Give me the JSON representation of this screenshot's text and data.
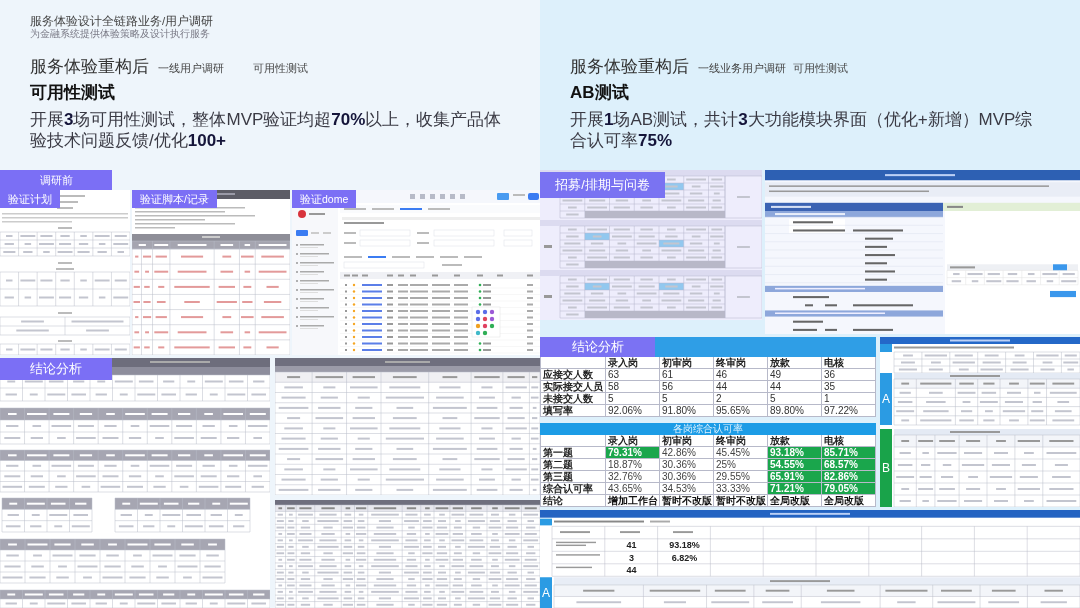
{
  "intro": {
    "title": "服务体验设计全链路业务/用户调研",
    "subtitle": "为金融系统提供体验策略及设计执行服务"
  },
  "panels": [
    {
      "heading": "服务体验重构后",
      "steps": [
        "一线用户调研",
        "可用性测试"
      ],
      "subheading": "可用性测试",
      "summary": "开展**3**场可用性测试，整体MVP验证均超**70%**以上，收集产品体验技术问题反馈/优化**100+**",
      "stage_tag": "调研前",
      "documents": [
        {
          "kind": "plan",
          "tag": "验证计划"
        },
        {
          "kind": "script",
          "tag": "验证脚本/记录"
        },
        {
          "kind": "app",
          "tag": "验证dome"
        },
        {
          "kind": "sheets",
          "tag": "结论分析"
        },
        {
          "kind": "issues"
        },
        {
          "kind": "log"
        }
      ]
    },
    {
      "heading": "服务体验重构后",
      "steps": [
        "一线业务用户调研",
        "可用性测试"
      ],
      "subheading": "AB测试",
      "summary": "开展**1**场AB测试，共计**3**大功能模块界面（优化+新增）MVP综合认可率**75%**",
      "documents": [
        {
          "kind": "schedule",
          "tag": "招募/排期与问卷"
        },
        {
          "kind": "questionnaire"
        },
        {
          "kind": "ab",
          "groups": [
            "A",
            "B"
          ]
        },
        {
          "kind": "vote",
          "groups": [
            "A"
          ],
          "figures": [
            [
              "41",
              "93.18%"
            ],
            [
              "3",
              "6.82%"
            ],
            [
              "44"
            ]
          ]
        }
      ],
      "conclusion_tag": "结论分析",
      "response_table": {
        "columns": [
          "录入岗",
          "初审岗",
          "终审岗",
          "放款",
          "电核"
        ],
        "rows": [
          {
            "label": "应接交人数",
            "cells": [
              "63",
              "61",
              "46",
              "49",
              "36"
            ]
          },
          {
            "label": "实际接交人员",
            "cells": [
              "58",
              "56",
              "44",
              "44",
              "35"
            ]
          },
          {
            "label": "未接交人数",
            "cells": [
              "5",
              "5",
              "2",
              "5",
              "1"
            ]
          },
          {
            "label": "填写率",
            "cells": [
              "92.06%",
              "91.80%",
              "95.65%",
              "89.80%",
              "97.22%"
            ]
          }
        ]
      },
      "approval_table": {
        "title": "各岗综合认可率",
        "columns": [
          "录入岗",
          "初审岗",
          "终审岗",
          "放款",
          "电核"
        ],
        "rows": [
          {
            "kind": "score",
            "label": "第一题",
            "cells": [
              {
                "value": "79.31%",
                "highlighted": true
              },
              {
                "value": "42.86%",
                "highlighted": false
              },
              {
                "value": "45.45%",
                "highlighted": false
              },
              {
                "value": "93.18%",
                "highlighted": true
              },
              {
                "value": "85.71%",
                "highlighted": true
              }
            ]
          },
          {
            "kind": "score",
            "label": "第二题",
            "cells": [
              {
                "value": "18.87%",
                "highlighted": false
              },
              {
                "value": "30.36%",
                "highlighted": false
              },
              {
                "value": "25%",
                "highlighted": false
              },
              {
                "value": "54.55%",
                "highlighted": true
              },
              {
                "value": "68.57%",
                "highlighted": true
              }
            ]
          },
          {
            "kind": "score",
            "label": "第三题",
            "cells": [
              {
                "value": "32.76%",
                "highlighted": false
              },
              {
                "value": "30.36%",
                "highlighted": false
              },
              {
                "value": "29.55%",
                "highlighted": false
              },
              {
                "value": "65.91%",
                "highlighted": true
              },
              {
                "value": "82.86%",
                "highlighted": true
              }
            ]
          },
          {
            "kind": "score",
            "label": "综合认可率",
            "cells": [
              {
                "value": "43.65%",
                "highlighted": false
              },
              {
                "value": "34.53%",
                "highlighted": false
              },
              {
                "value": "33.33%",
                "highlighted": false
              },
              {
                "value": "71.21%",
                "highlighted": true
              },
              {
                "value": "79.05%",
                "highlighted": true
              }
            ]
          },
          {
            "kind": "conclusion",
            "label": "结论",
            "cells": [
              {
                "value": "增加工作台",
                "highlighted": false
              },
              {
                "value": "暂时不改版",
                "highlighted": false
              },
              {
                "value": "暂时不改版",
                "highlighted": false
              },
              {
                "value": "全局改版",
                "highlighted": false
              },
              {
                "value": "全局改版",
                "highlighted": false
              }
            ]
          }
        ]
      }
    }
  ]
}
